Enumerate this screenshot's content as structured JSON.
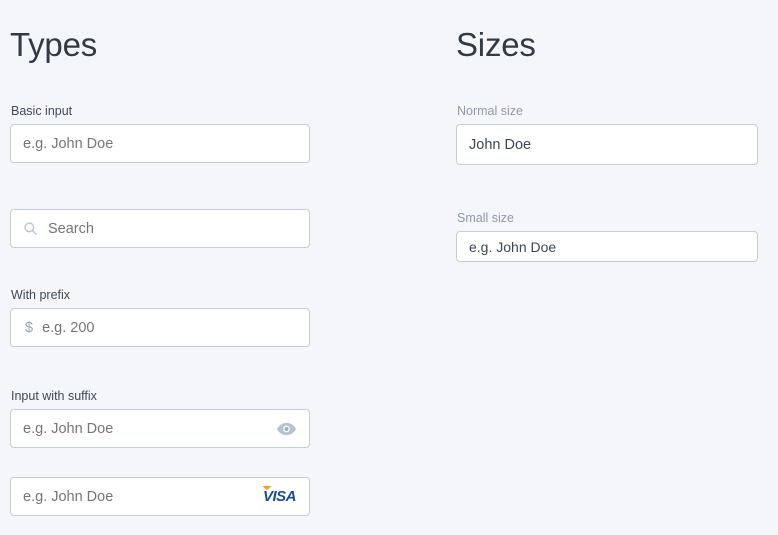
{
  "page": {
    "background_color": "#f4f6f9",
    "border_color": "#c3cdda",
    "input_background": "#ffffff",
    "placeholder_color": "#c2cbd8",
    "value_color": "#3c4654",
    "label_dark_color": "#3f4a5a",
    "label_muted_color": "#8f99aa",
    "accent_visa_blue": "#1a4b94",
    "accent_visa_gold": "#f2a100"
  },
  "types": {
    "title": "Types",
    "fields": [
      {
        "label": "Basic input",
        "placeholder": "e.g. John Doe",
        "value": "",
        "lead_icon": "",
        "prefix": "",
        "suffix_icon": ""
      },
      {
        "label": "",
        "placeholder": "Search",
        "value": "",
        "lead_icon": "search-icon",
        "prefix": "",
        "suffix_icon": ""
      },
      {
        "label": "With prefix",
        "placeholder": "e.g. 200",
        "value": "",
        "lead_icon": "",
        "prefix": "$",
        "suffix_icon": ""
      },
      {
        "label": "Input with suffix",
        "placeholder": "e.g. John Doe",
        "value": "",
        "lead_icon": "",
        "prefix": "",
        "suffix_icon": "eye-icon"
      },
      {
        "label": "",
        "placeholder": "e.g. John Doe",
        "value": "",
        "lead_icon": "",
        "prefix": "",
        "suffix_icon": "visa-logo",
        "suffix_brand_text": "VISA"
      }
    ]
  },
  "sizes": {
    "title": "Sizes",
    "fields": [
      {
        "label": "Normal size",
        "placeholder": "e.g. John Doe",
        "value": "John Doe",
        "size": "normal"
      },
      {
        "label": "Small size",
        "placeholder": "e.g. John Doe",
        "value": "e.g. John Doe",
        "size": "small"
      }
    ]
  }
}
